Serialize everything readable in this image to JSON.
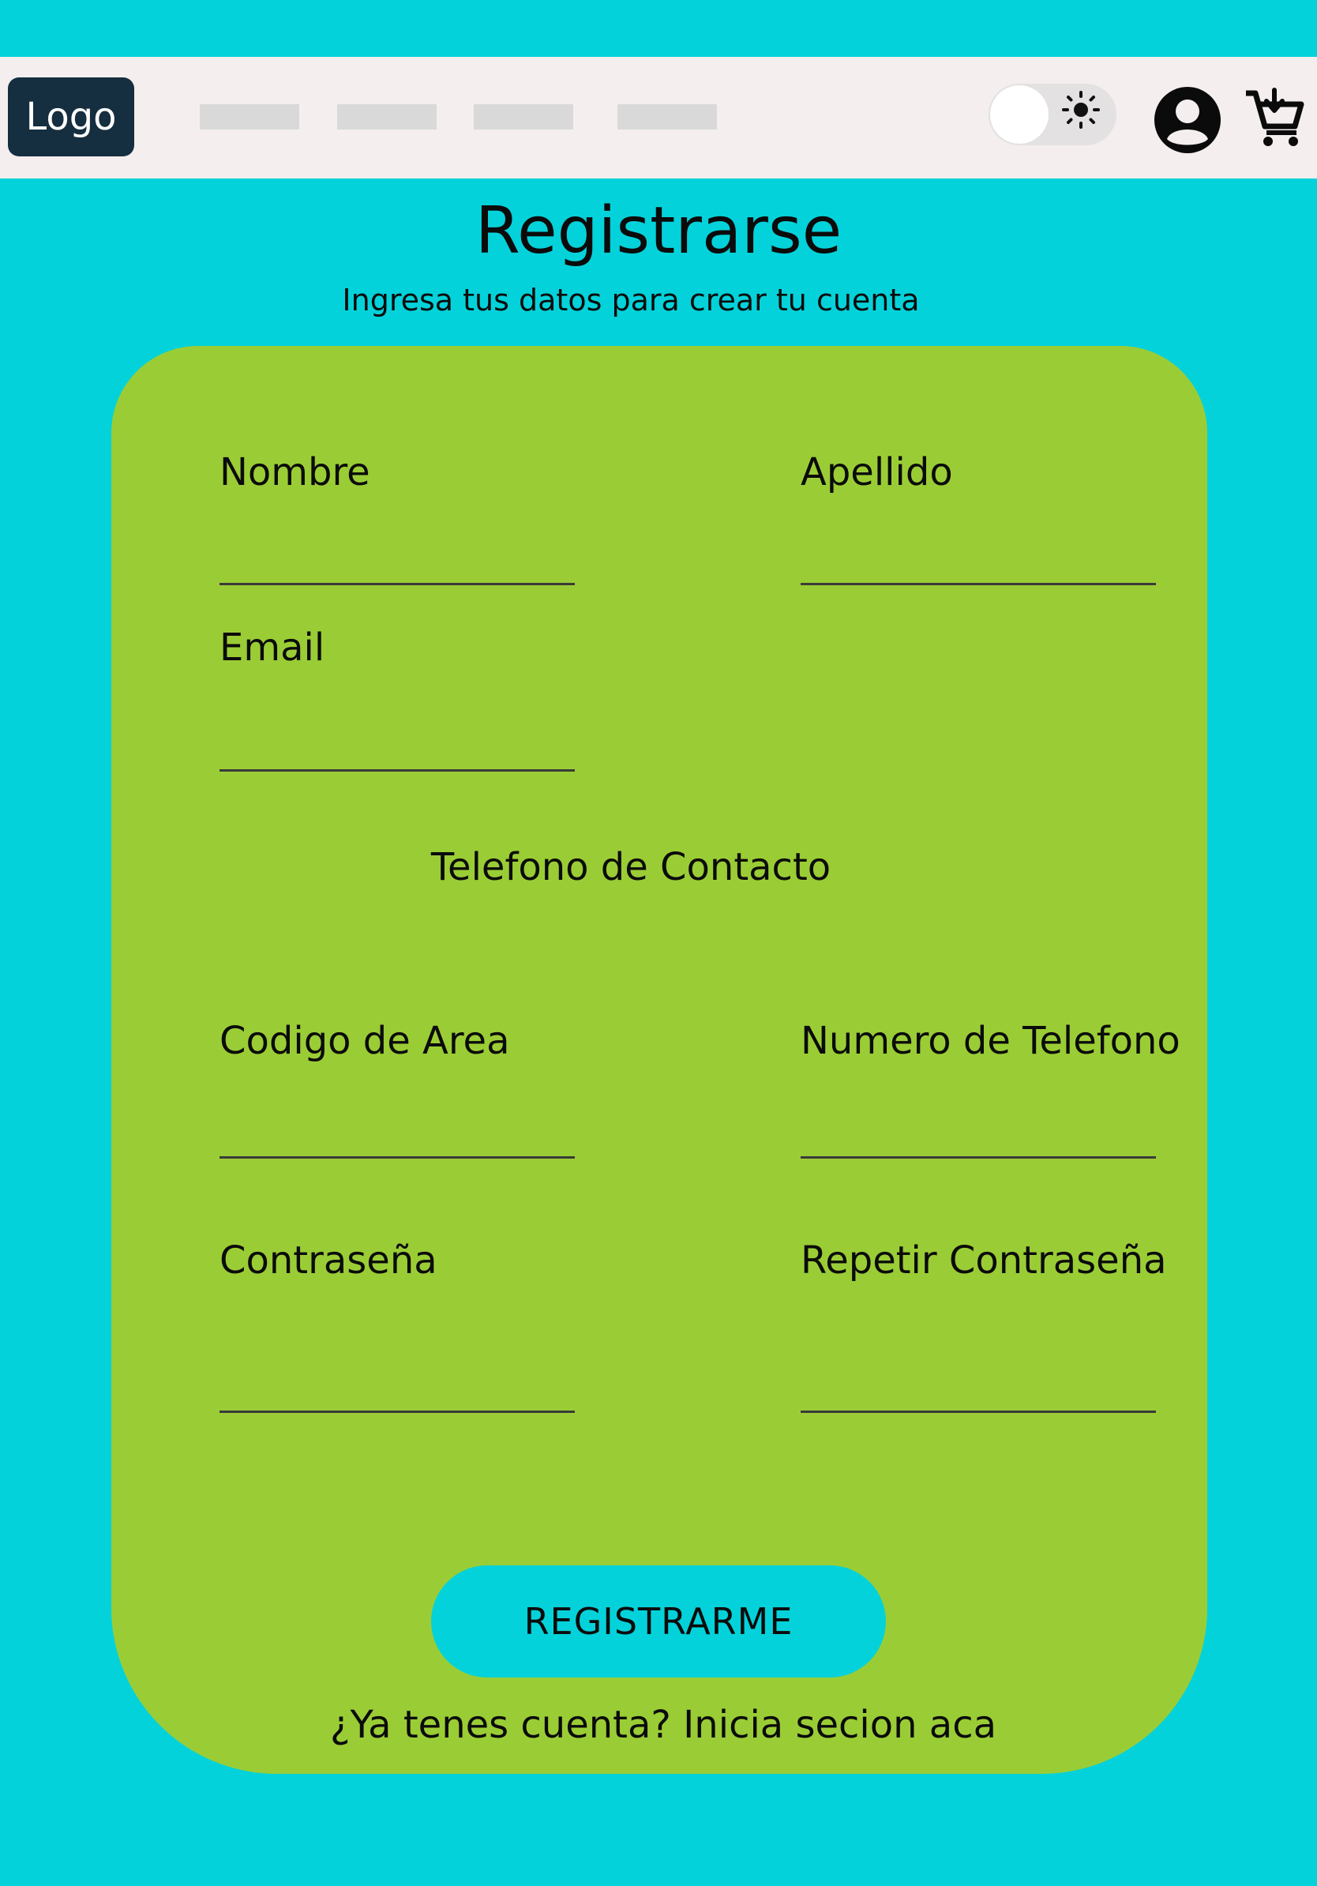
{
  "navbar": {
    "logo_label": "Logo",
    "nav_links": [
      "",
      "",
      "",
      ""
    ],
    "theme_toggle": {
      "state": "light",
      "icon": "sun-icon"
    },
    "user_icon": "user-circle-icon",
    "cart_icon": "cart-icon"
  },
  "page": {
    "title": "Registrarse",
    "subtitle": "Ingresa tus datos para crear tu cuenta"
  },
  "form": {
    "fields": {
      "nombre": {
        "label": "Nombre",
        "value": ""
      },
      "apellido": {
        "label": "Apellido",
        "value": ""
      },
      "email": {
        "label": "Email",
        "value": ""
      },
      "codigo_area": {
        "label": "Codigo de Area",
        "value": ""
      },
      "numero_telefono": {
        "label": "Numero de Telefono",
        "value": ""
      },
      "contrasena": {
        "label": "Contraseña",
        "value": ""
      },
      "repetir_contrasena": {
        "label": "Repetir Contraseña",
        "value": ""
      }
    },
    "contact_heading": "Telefono de Contacto",
    "submit_label": "REGISTRARME",
    "login_prompt": "¿Ya tenes cuenta? Inicia secion aca"
  },
  "colors": {
    "background": "#04d2da",
    "navbar": "#f4eeee",
    "logo_bg": "#152e40",
    "card": "#9acd35",
    "button": "#04d2da",
    "nav_placeholder": "#d9d9d9"
  }
}
